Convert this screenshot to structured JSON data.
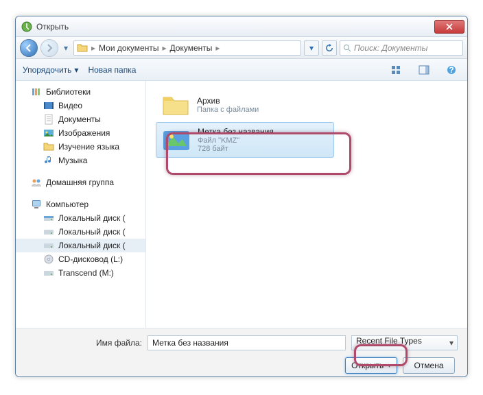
{
  "title": "Открыть",
  "breadcrumb": {
    "b1": "Мои документы",
    "b2": "Документы"
  },
  "search_placeholder": "Поиск: Документы",
  "toolbar": {
    "organize": "Упорядочить",
    "newfolder": "Новая папка"
  },
  "sidebar": {
    "lib": "Библиотеки",
    "video": "Видео",
    "docs": "Документы",
    "images": "Изображения",
    "study": "Изучение языка",
    "music": "Музыка",
    "homegroup": "Домашняя группа",
    "computer": "Компьютер",
    "disk1": "Локальный диск (",
    "disk2": "Локальный диск (",
    "disk3": "Локальный диск (",
    "cd": "CD-дисковод (L:)",
    "transcend": "Transcend (M:)"
  },
  "files": {
    "archive": {
      "name": "Архив",
      "meta": "Папка с файлами"
    },
    "kmz": {
      "name": "Метка без названия",
      "type": "Файл \"KMZ\"",
      "size": "728 байт"
    }
  },
  "filename_label": "Имя файла:",
  "filename_value": "Метка без названия",
  "filetype": "Recent File Types",
  "open_btn": "Открыть",
  "cancel_btn": "Отмена"
}
